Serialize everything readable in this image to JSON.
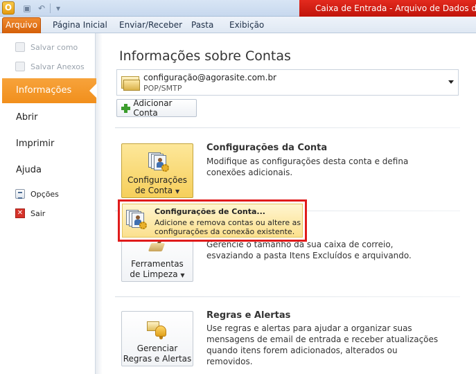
{
  "titlebar": {
    "app_icon": "O",
    "window_title": "Caixa de Entrada - Arquivo de Dados do Out"
  },
  "ribbon": {
    "file_tab": "Arquivo",
    "tabs": [
      "Página Inicial",
      "Enviar/Receber",
      "Pasta",
      "Exibição"
    ]
  },
  "leftnav": {
    "save_as": "Salvar como",
    "save_attachments": "Salvar Anexos",
    "selected": "Informações",
    "open": "Abrir",
    "print": "Imprimir",
    "help": "Ajuda",
    "options": "Opções",
    "exit": "Sair"
  },
  "main": {
    "title": "Informações sobre Contas",
    "account": {
      "email": "configuração@agorasite.com.br",
      "type": "POP/SMTP"
    },
    "add_account": "Adicionar Conta",
    "sections": {
      "account_settings": {
        "button_line1": "Configurações",
        "button_line2": "de Conta",
        "title": "Configurações da Conta",
        "description": "Modifique as configurações desta conta e defina conexões adicionais."
      },
      "cleanup": {
        "button_line1": "Ferramentas",
        "button_line2": "de Limpeza",
        "description": "Gerencie o tamanho da sua caixa de correio, esvaziando a pasta Itens Excluídos e arquivando."
      },
      "rules": {
        "button_line1": "Gerenciar",
        "button_line2": "Regras e Alertas",
        "title": "Regras e Alertas",
        "description": "Use regras e alertas para ajudar a organizar suas mensagens de email de entrada e receber atualizações quando itens forem adicionados, alterados ou removidos."
      }
    },
    "menu": {
      "item_title": "Configurações de Conta...",
      "item_description": "Adicione e remova contas ou altere as configurações da conexão existente."
    }
  },
  "colors": {
    "accent_orange": "#f18f1c",
    "title_red": "#c0140a",
    "highlight_border": "#e01b1b"
  }
}
